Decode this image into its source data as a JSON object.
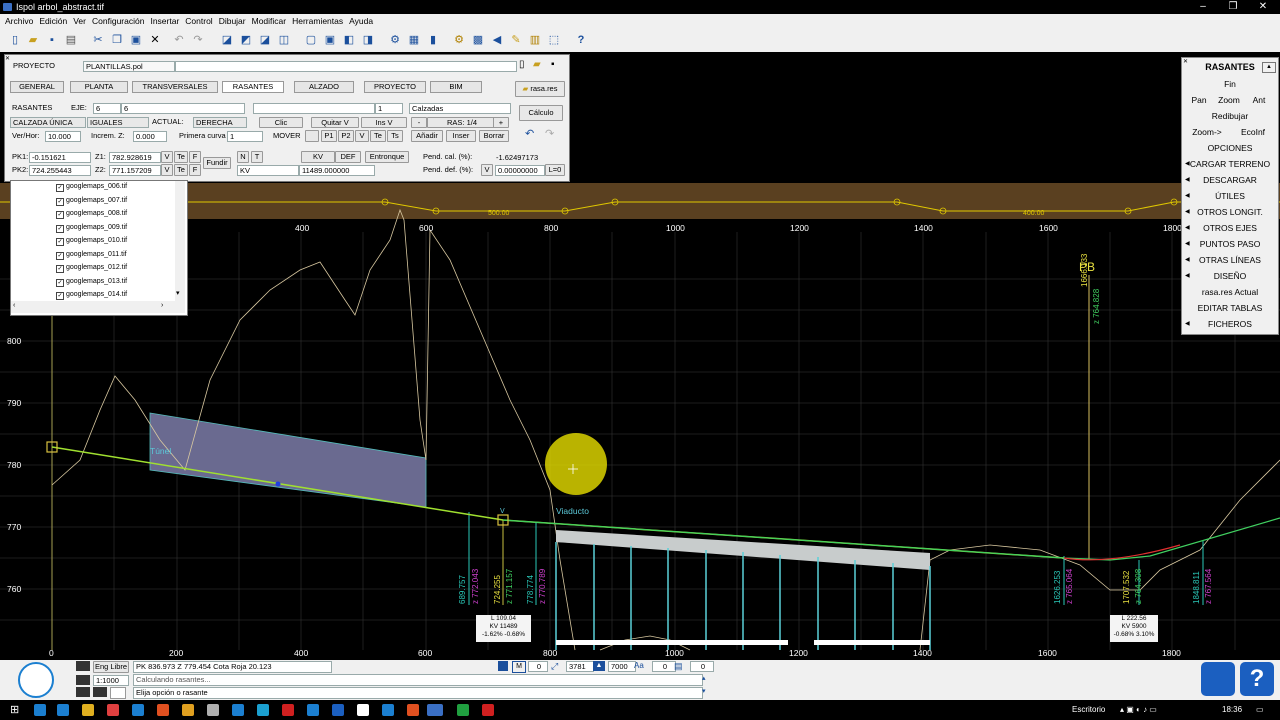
{
  "app": {
    "title": "Ispol  arbol_abstract.tif"
  },
  "menu": [
    "Archivo",
    "Edición",
    "Ver",
    "Configuración",
    "Insertar",
    "Control",
    "Dibujar",
    "Modificar",
    "Herramientas",
    "Ayuda"
  ],
  "panel": {
    "proyecto_label": "PROYECTO",
    "proyecto_value": "PLANTILLAS.pol",
    "tabs": [
      "GENERAL",
      "PLANTA",
      "TRANSVERSALES",
      "RASANTES",
      "ALZADO",
      "PROYECTO",
      "BIM"
    ],
    "active_tab": "RASANTES",
    "rasa_file": "rasa.res",
    "rasantes_label": "RASANTES",
    "eje_label": "EJE:",
    "eje_value1": "6",
    "eje_value2": "6",
    "num_value": "1",
    "calzadas": "Calzadas",
    "calculo": "Cálculo",
    "calzada_unica": "CALZADA ÚNICA",
    "iguales": "IGUALES",
    "actual_label": "ACTUAL:",
    "derecha": "DERECHA",
    "clic": "Clic",
    "quitar_v": "Quitar V",
    "ins_v": "Ins V",
    "minus": "-",
    "ras": "RAS: 1/4",
    "plus": "+",
    "verhor_label": "Ver/Hor:",
    "verhor_value": "10.000",
    "increm_label": "Increm. Z:",
    "increm_value": "0.000",
    "primera_label": "Primera curva",
    "primera_value": "1",
    "mover": "MOVER",
    "p1": "P1",
    "p2": "P2",
    "v": "V",
    "te": "Te",
    "ts": "Ts",
    "anadir": "Añadir",
    "inser": "Inser",
    "borrar": "Borrar",
    "pk1_label": "PK1:",
    "pk1_value": "-0.151621",
    "z1_label": "Z1:",
    "z1_value": "782.928619",
    "pk2_label": "PK2:",
    "pk2_value": "724.255443",
    "z2_label": "Z2:",
    "z2_value": "771.157209",
    "fundir": "Fundir",
    "n": "N",
    "t": "T",
    "kv": "KV",
    "def": "DEF",
    "entronque": "Entronque",
    "kv_sel": "KV",
    "kv_value": "11489.000000",
    "pend_cal_label": "Pend. cal. (%):",
    "pend_cal_value": "-1.62497173",
    "pend_def_label": "Pend. def. (%):",
    "pend_def_value": "0.00000000",
    "l0": "L=0",
    "vbtn": "V",
    "fbtn": "F"
  },
  "layers": [
    "googlemaps_006.tif",
    "googlemaps_007.tif",
    "googlemaps_008.tif",
    "googlemaps_009.tif",
    "googlemaps_010.tif",
    "googlemaps_011.tif",
    "googlemaps_012.tif",
    "googlemaps_013.tif",
    "googlemaps_014.tif"
  ],
  "right_panel": {
    "title": "RASANTES",
    "fin": "Fin",
    "pan": "Pan",
    "zoom": "Zoom",
    "ant": "Ant",
    "redibujar": "Redibujar",
    "zoom_arrow": "Zoom->",
    "ecoinf": "EcoInf",
    "items": [
      "OPCIONES",
      "CARGAR TERRENO",
      "DESCARGAR",
      "ÚTILES",
      "OTROS LONGIT.",
      "OTROS EJES",
      "PUNTOS PASO",
      "OTRAS LÍNEAS",
      "DISEÑO",
      "rasa.res Actual",
      "EDITAR TABLAS",
      "FICHEROS"
    ]
  },
  "drawing": {
    "top_axis": [
      "400",
      "600",
      "800",
      "1000",
      "1200",
      "1400",
      "1600",
      "1800"
    ],
    "bottom_axis": [
      "0",
      "200",
      "400",
      "600",
      "800",
      "1000",
      "1200",
      "1400",
      "1600",
      "1800"
    ],
    "y_axis": [
      "800",
      "790",
      "780",
      "770",
      "760"
    ],
    "band_labels": [
      "500.00",
      "400.00"
    ],
    "tunel": "Túnel",
    "viaducto": "Viaducto",
    "v_marker": "V",
    "pb": "PB",
    "pb_pk": "1666.133",
    "pb_z": "z 764.828",
    "vlabels": [
      {
        "pk": "689.757",
        "z": "z 772.043"
      },
      {
        "pk": "724.255",
        "z": "z 771.157"
      },
      {
        "pk": "778.774",
        "z": "z 770.789"
      },
      {
        "pk": "1626.253",
        "z": "z 765.064"
      },
      {
        "pk": "1707.532",
        "z": "z 764.308"
      },
      {
        "pk": "1848.811",
        "z": "z 767.564"
      }
    ],
    "box1": [
      "L 109.04",
      "KV 11489",
      "-1.62% -0.68%"
    ],
    "box2": [
      "L 222.56",
      "KV 5900",
      "-0.68% 3.10%"
    ]
  },
  "status": {
    "eng_libre": "Eng Libre",
    "scale": "1:1000",
    "coords": "PK   836.973 Z   779.454 Cota Roja 20.123",
    "msg1": "Calculando rasantes...",
    "msg2": "Elija opción o rasante",
    "f1": "0",
    "f2": "3781",
    "f3": "7000",
    "aa": "Aa",
    "f4": "0",
    "f5": "0"
  },
  "taskbar": {
    "escritorio": "Escritorio",
    "time": "18:36"
  }
}
